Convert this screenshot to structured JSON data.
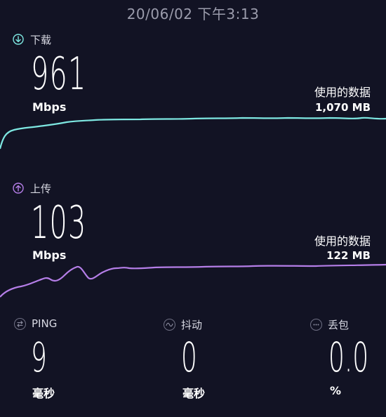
{
  "status": {
    "timestamp": "20/06/02 下午3:13"
  },
  "download": {
    "label": "下载",
    "value": "961",
    "unit": "Mbps",
    "usage_label": "使用的数据",
    "usage_value": "1,070 MB",
    "color": "#7ee8e2",
    "icon": "arrow-down-circle-icon"
  },
  "upload": {
    "label": "上传",
    "value": "103",
    "unit": "Mbps",
    "usage_label": "使用的数据",
    "usage_value": "122 MB",
    "color": "#b57ee8",
    "icon": "arrow-up-circle-icon"
  },
  "metrics": {
    "ping": {
      "label": "PING",
      "value": "9",
      "unit": "毫秒",
      "icon": "ping-icon"
    },
    "jitter": {
      "label": "抖动",
      "value": "0",
      "unit": "毫秒",
      "icon": "jitter-icon"
    },
    "loss": {
      "label": "丢包",
      "value": "0.0",
      "unit": "%",
      "icon": "packet-loss-icon"
    }
  }
}
